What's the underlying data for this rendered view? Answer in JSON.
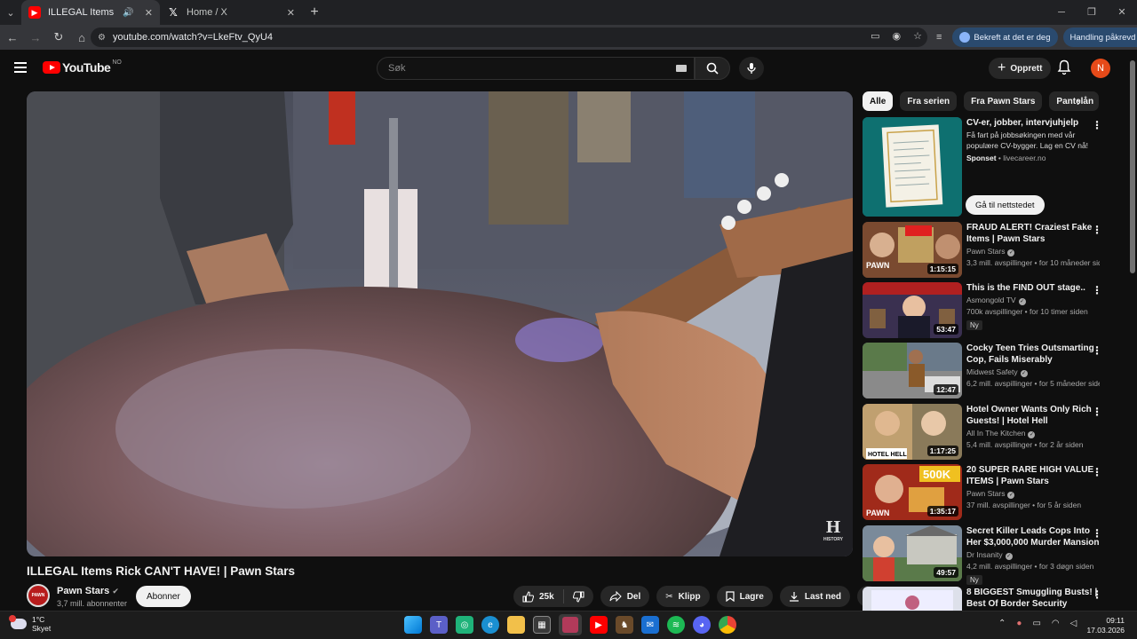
{
  "browser": {
    "tabs": [
      {
        "title": "ILLEGAL Items Rick CAN'T HAVE! | Pawn Stars",
        "active": true,
        "favicon": "youtube-icon"
      },
      {
        "title": "Home / X",
        "active": false,
        "favicon": "x-icon"
      }
    ],
    "url": "youtube.com/watch?v=LkeFtv_QyU4",
    "pill_verify": "Bekreft at det er deg",
    "pill_action": "Handling påkrevd"
  },
  "header": {
    "logo_text": "YouTube",
    "logo_region": "NO",
    "search_placeholder": "Søk",
    "create_label": "Opprett",
    "avatar_letter": "N"
  },
  "video": {
    "title": "ILLEGAL Items Rick CAN'T HAVE! | Pawn Stars",
    "watermark": "HISTORY",
    "watermark_letter": "H",
    "channel": {
      "name": "Pawn Stars",
      "subscribers": "3,7 mill. abonnenter",
      "avatar_text": "PAWN"
    },
    "subscribe_label": "Abonner",
    "like_count": "25k",
    "share_label": "Del",
    "clip_label": "Klipp",
    "save_label": "Lagre",
    "download_label": "Last ned"
  },
  "chips": [
    "Alle",
    "Fra serien",
    "Fra Pawn Stars",
    "Pantelån"
  ],
  "ad": {
    "title": "CV-er, jobber, intervjuhjelp",
    "description": "Få fart på jobbsøkingen med vår populære CV-bygger. Lag en CV nå!",
    "sponsored": "Sponset",
    "advertiser": "livecareer.no",
    "cta": "Gå til nettstedet"
  },
  "recommendations": [
    {
      "title": "FRAUD ALERT! Craziest Fake Items | Pawn Stars",
      "channel": "Pawn Stars",
      "verified": true,
      "meta": "3,3 mill. avspillinger • for 10 måneder siden",
      "duration": "1:15:15",
      "badge": "",
      "thumb_color": "#6b3a2a"
    },
    {
      "title": "This is the FIND OUT stage..",
      "channel": "Asmongold TV",
      "verified": true,
      "meta": "700k avspillinger • for 10 timer siden",
      "duration": "53:47",
      "badge": "Ny",
      "thumb_color": "#4a3a5a"
    },
    {
      "title": "Cocky Teen Tries Outsmarting Cop, Fails Miserably",
      "channel": "Midwest Safety",
      "verified": true,
      "meta": "6,2 mill. avspillinger • for 5 måneder siden",
      "duration": "12:47",
      "badge": "",
      "thumb_color": "#5a6a4a"
    },
    {
      "title": "Hotel Owner Wants Only Rich Guests! | Hotel Hell",
      "channel": "All In The Kitchen",
      "verified": true,
      "meta": "5,4 mill. avspillinger • for 2 år siden",
      "duration": "1:17:25",
      "badge": "",
      "thumb_color": "#7a6a4a"
    },
    {
      "title": "20 SUPER RARE HIGH VALUE ITEMS | Pawn Stars",
      "channel": "Pawn Stars",
      "verified": true,
      "meta": "37 mill. avspillinger • for 5 år siden",
      "duration": "1:35:17",
      "badge": "",
      "thumb_color": "#a03020"
    },
    {
      "title": "Secret Killer Leads Cops Into Her $3,000,000 Murder Mansion",
      "channel": "Dr Insanity",
      "verified": true,
      "meta": "4,2 mill. avspillinger • for 3 døgn siden",
      "duration": "49:57",
      "badge": "Ny",
      "thumb_color": "#5a6a5a"
    },
    {
      "title": "8 BIGGEST Smuggling Busts! | Best Of Border Security",
      "channel": "",
      "verified": false,
      "meta": "",
      "duration": "",
      "badge": "",
      "thumb_color": "#8a8a9a"
    }
  ],
  "taskbar": {
    "temp": "1°C",
    "condition": "Skyet",
    "time": "09:11",
    "date": "17.03.2026"
  },
  "colors": {
    "accent_red": "#ff0000",
    "bg": "#0f0f0f",
    "chip_bg": "#272727"
  }
}
